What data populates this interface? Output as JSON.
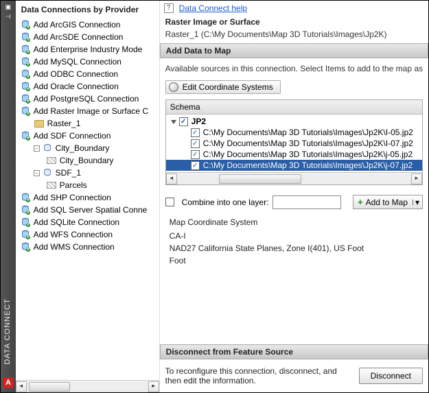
{
  "strip": {
    "title": "DATA CONNECT",
    "logo": "A"
  },
  "left": {
    "title": "Data Connections by Provider",
    "items": [
      {
        "label": "Add ArcGIS Connection",
        "type": "db"
      },
      {
        "label": "Add ArcSDE Connection",
        "type": "db"
      },
      {
        "label": "Add Enterprise Industry Mode",
        "type": "db"
      },
      {
        "label": "Add MySQL Connection",
        "type": "db"
      },
      {
        "label": "Add ODBC Connection",
        "type": "db"
      },
      {
        "label": "Add Oracle Connection",
        "type": "db"
      },
      {
        "label": "Add PostgreSQL Connection",
        "type": "db"
      },
      {
        "label": "Add Raster Image or Surface C",
        "type": "db",
        "children": [
          {
            "label": "Raster_1",
            "type": "folder"
          }
        ]
      },
      {
        "label": "Add SDF Connection",
        "type": "db",
        "children": [
          {
            "label": "City_Boundary",
            "type": "node",
            "expanded": true,
            "children": [
              {
                "label": "City_Boundary",
                "type": "layer"
              }
            ]
          },
          {
            "label": "SDF_1",
            "type": "node",
            "expanded": true,
            "children": [
              {
                "label": "Parcels",
                "type": "layer"
              }
            ]
          }
        ]
      },
      {
        "label": "Add SHP Connection",
        "type": "db"
      },
      {
        "label": "Add SQL Server Spatial Conne",
        "type": "db"
      },
      {
        "label": "Add SQLite Connection",
        "type": "db"
      },
      {
        "label": "Add WFS Connection",
        "type": "db"
      },
      {
        "label": "Add WMS Connection",
        "type": "db"
      }
    ]
  },
  "help": {
    "label": "Data Connect help"
  },
  "header": {
    "title": "Raster Image or Surface",
    "path": "Raster_1 (C:\\My Documents\\Map 3D Tutorials\\Images\\Jp2K)"
  },
  "addbar": {
    "title": "Add Data to Map"
  },
  "available": "Available sources in this connection.   Select Items to add to the map as",
  "coordBtn": "Edit Coordinate Systems",
  "schema": {
    "header": "Schema",
    "root": "JP2",
    "rows": [
      {
        "label": "C:\\My Documents\\Map 3D Tutorials\\Images\\Jp2K\\I-05.jp2",
        "checked": true,
        "selected": false
      },
      {
        "label": "C:\\My Documents\\Map 3D Tutorials\\Images\\Jp2K\\I-07.jp2",
        "checked": true,
        "selected": false
      },
      {
        "label": "C:\\My Documents\\Map 3D Tutorials\\Images\\Jp2K\\j-05.jp2",
        "checked": true,
        "selected": false
      },
      {
        "label": "C:\\My Documents\\Map 3D Tutorials\\Images\\Jp2K\\j-07.jp2",
        "checked": true,
        "selected": true
      }
    ]
  },
  "combine": {
    "label": "Combine into one layer:",
    "value": ""
  },
  "addMap": "Add to Map",
  "coord": {
    "title": "Map Coordinate System",
    "line1": "CA-I",
    "line2": "NAD27 California State Planes, Zone I(401), US Foot",
    "line3": "Foot"
  },
  "disconnect": {
    "bar": "Disconnect from Feature Source",
    "text": "To reconfigure this connection, disconnect, and then edit the information.",
    "btn": "Disconnect"
  }
}
